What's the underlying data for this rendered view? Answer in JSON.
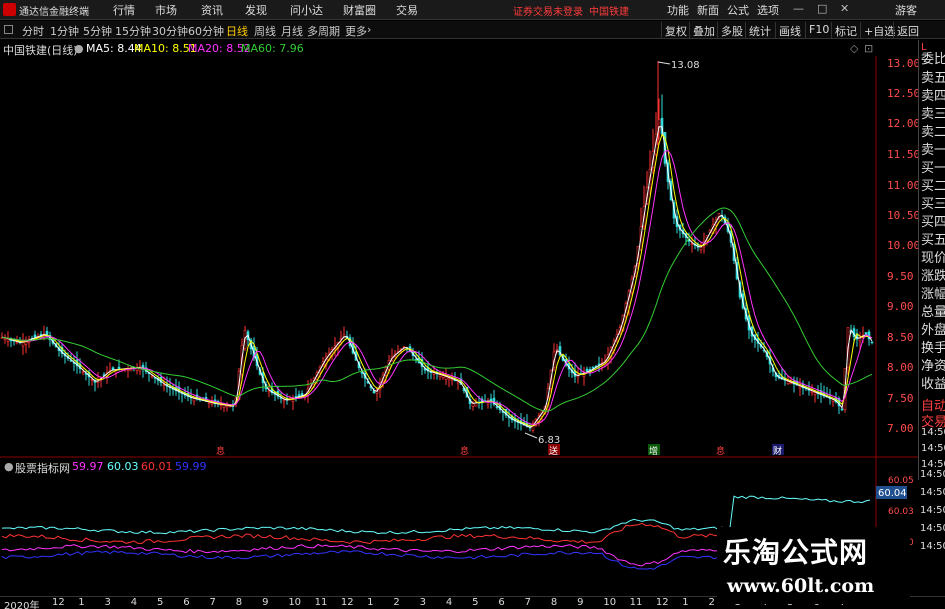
{
  "menubar": {
    "app_title": "通达信金融终端",
    "items": [
      "行情",
      "市场",
      "资讯",
      "发现",
      "问小达",
      "财富圈",
      "交易"
    ],
    "warning": "证券交易未登录",
    "stock_name": "中国铁建",
    "right_items": [
      "功能",
      "新面",
      "公式",
      "选项"
    ],
    "guest": "游客",
    "window_controls": [
      "—",
      "□",
      "✕"
    ]
  },
  "periodbar": {
    "periods": [
      "分时",
      "1分钟",
      "5分钟",
      "15分钟",
      "30分钟",
      "60分钟",
      "日线",
      "周线",
      "月线",
      "多周期",
      "更多"
    ],
    "active_period": "日线",
    "tools": [
      "复权",
      "叠加",
      "多股",
      "统计",
      "画线",
      "F10",
      "标记",
      "+自选",
      "返回"
    ]
  },
  "chart_header": {
    "title": "中国铁建(日线)",
    "ma_labels": [
      {
        "label": "MA5: 8.44",
        "color": "#ffffff"
      },
      {
        "label": "MA10: 8.51",
        "color": "#ffff00"
      },
      {
        "label": "MA20: 8.52",
        "color": "#ff33ff"
      },
      {
        "label": "MA60: 7.96",
        "color": "#33cc33"
      }
    ]
  },
  "price_axis": [
    "13.00",
    "12.50",
    "12.00",
    "11.50",
    "11.00",
    "10.50",
    "10.00",
    "9.50",
    "9.00",
    "8.50",
    "8.00",
    "7.50",
    "7.00"
  ],
  "annotations": {
    "high": "13.08",
    "low": "6.83"
  },
  "side_panel": {
    "top_label": "L",
    "items": [
      "委比",
      "卖五",
      "卖四",
      "卖三",
      "卖二",
      "卖一",
      "买一",
      "买二",
      "买三",
      "买四",
      "买五",
      "现价",
      "涨跌",
      "涨幅",
      "总量",
      "外盘",
      "换手",
      "净资",
      "收益",
      "自动",
      "交易"
    ],
    "times": [
      "14:50",
      "14:50",
      "14:50",
      "14:50",
      "14:50",
      "14:50",
      "14:50",
      "14:50"
    ]
  },
  "indicator": {
    "title": "股票指标网",
    "values": [
      {
        "label": "59.97",
        "color": "#ff33ff"
      },
      {
        "label": "60.03",
        "color": "#66ffff"
      },
      {
        "label": "60.01",
        "color": "#ff3333"
      },
      {
        "label": "59.99",
        "color": "#3333ff"
      }
    ],
    "axis_labels": [
      "60.05",
      "60.04",
      "60.03",
      "60.00"
    ]
  },
  "event_markers": [
    "息",
    "息",
    "送",
    "增",
    "息",
    "财"
  ],
  "time_axis": [
    "2020年",
    "12",
    "1",
    "3",
    "4",
    "5",
    "6",
    "7",
    "8",
    "9",
    "10",
    "11",
    "12",
    "1",
    "2",
    "3",
    "4",
    "5",
    "6",
    "7",
    "8",
    "9",
    "10",
    "11",
    "12",
    "1",
    "2",
    "3",
    "4",
    "5",
    "6",
    "7"
  ],
  "watermark": {
    "title": "乐淘公式网",
    "url": "www.60lt.com"
  }
}
